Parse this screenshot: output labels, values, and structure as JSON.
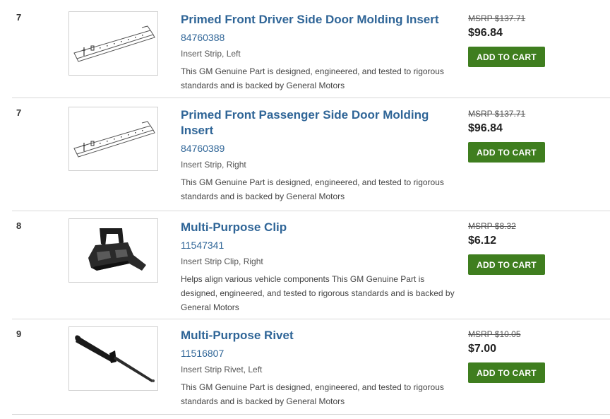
{
  "items": [
    {
      "num": "7",
      "title": "Primed Front Driver Side Door Molding Insert",
      "part_number": "84760388",
      "subtitle": "Insert Strip, Left",
      "description": "This GM Genuine Part is designed, engineered, and tested to rigorous standards and is backed by General Motors",
      "msrp": "MSRP $137.71",
      "price": "$96.84",
      "cart_label": "ADD TO CART",
      "image": "molding-strip-icon"
    },
    {
      "num": "7",
      "title": "Primed Front Passenger Side Door Molding Insert",
      "part_number": "84760389",
      "subtitle": "Insert Strip, Right",
      "description": "This GM Genuine Part is designed, engineered, and tested to rigorous standards and is backed by General Motors",
      "msrp": "MSRP $137.71",
      "price": "$96.84",
      "cart_label": "ADD TO CART",
      "image": "molding-strip-icon"
    },
    {
      "num": "8",
      "title": "Multi-Purpose Clip",
      "part_number": "11547341",
      "subtitle": "Insert Strip Clip, Right",
      "description": "Helps align various vehicle components This GM Genuine Part is designed, engineered, and tested to rigorous standards and is backed by General Motors",
      "msrp": "MSRP $8.32",
      "price": "$6.12",
      "cart_label": "ADD TO CART",
      "image": "clip-icon"
    },
    {
      "num": "9",
      "title": "Multi-Purpose Rivet",
      "part_number": "11516807",
      "subtitle": "Insert Strip Rivet, Left",
      "description": "This GM Genuine Part is designed, engineered, and tested to rigorous standards and is backed by General Motors",
      "msrp": "MSRP $10.05",
      "price": "$7.00",
      "cart_label": "ADD TO CART",
      "image": "rivet-icon"
    }
  ],
  "colors": {
    "link": "#2f6597",
    "cart_button": "#3f7e1f"
  }
}
